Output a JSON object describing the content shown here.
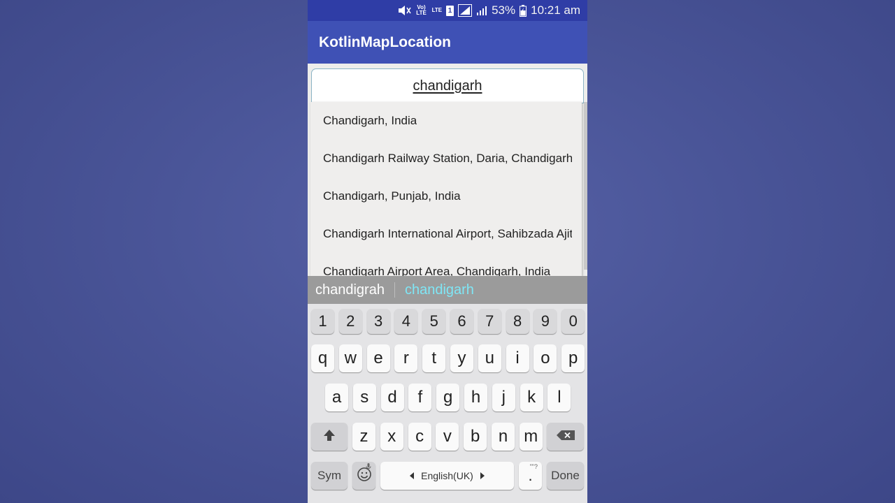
{
  "status_bar": {
    "volte_label": "Vo)\nLTE",
    "lte_label": "LTE",
    "sim_label": "1",
    "battery_text": "53%",
    "clock": "10:21 am"
  },
  "app_bar": {
    "title": "KotlinMapLocation"
  },
  "search": {
    "value": "chandigarh"
  },
  "suggestions": [
    "Chandigarh, India",
    "Chandigarh Railway Station, Daria, Chandigarh, India",
    "Chandigarh, Punjab, India",
    "Chandigarh International Airport, Sahibzada Ajit Singh Nagar, India",
    "Chandigarh Airport Area, Chandigarh, India"
  ],
  "keyboard": {
    "predictions": [
      "chandigrah",
      "chandigarh"
    ],
    "number_row": [
      "1",
      "2",
      "3",
      "4",
      "5",
      "6",
      "7",
      "8",
      "9",
      "0"
    ],
    "row1": [
      "q",
      "w",
      "e",
      "r",
      "t",
      "y",
      "u",
      "i",
      "o",
      "p"
    ],
    "row2": [
      "a",
      "s",
      "d",
      "f",
      "g",
      "h",
      "j",
      "k",
      "l"
    ],
    "row3": [
      "z",
      "x",
      "c",
      "v",
      "b",
      "n",
      "m"
    ],
    "sym_label": "Sym",
    "space_label": "English(UK)",
    "period_label": ".",
    "period_hint": "\"\"?",
    "done_label": "Done",
    "prediction_color": "#7fe6f5"
  }
}
